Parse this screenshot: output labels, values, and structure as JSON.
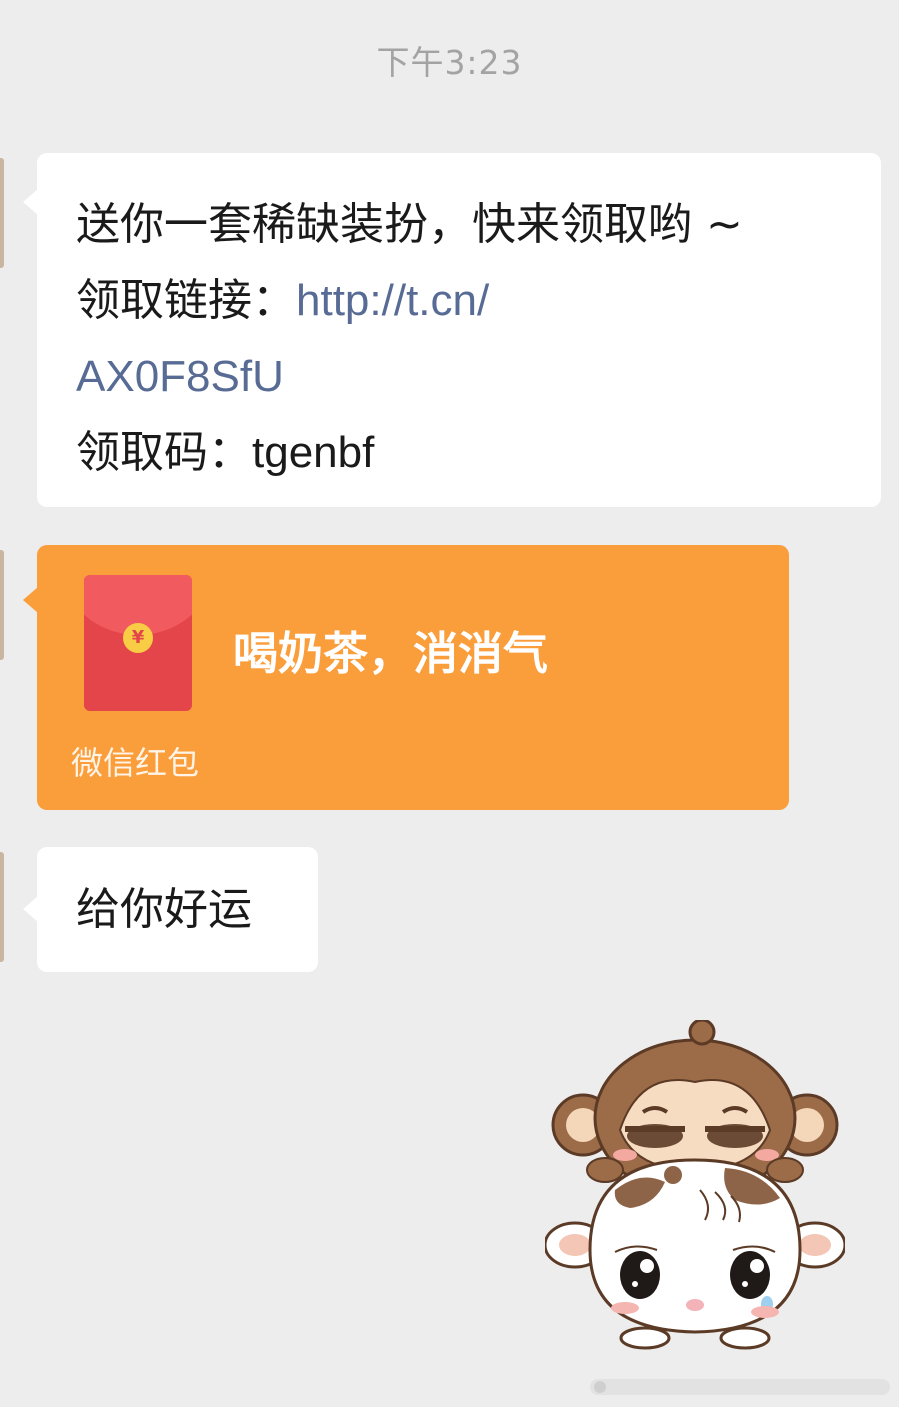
{
  "chat": {
    "timestamp": "下午3:23",
    "messages": {
      "link_message": {
        "line1": "送你一套稀缺装扮，快来领取哟 ~",
        "line2_label": "领取链接：",
        "link_part1": "http://t.cn/",
        "link_part2": "AX0F8SfU",
        "line4_label": "领取码：",
        "code": "tgenbf"
      },
      "red_packet": {
        "title": "喝奶茶，消消气",
        "footer": "微信红包",
        "coin_symbol": "¥"
      },
      "luck_message": {
        "text": "给你好运"
      }
    },
    "sticker": {
      "description_icon": "monkey-on-cow-sticker"
    }
  },
  "colors": {
    "background": "#ededed",
    "bubble": "#ffffff",
    "link": "#576b95",
    "red_packet": "#fa9d3b",
    "envelope": "#e4454a"
  }
}
